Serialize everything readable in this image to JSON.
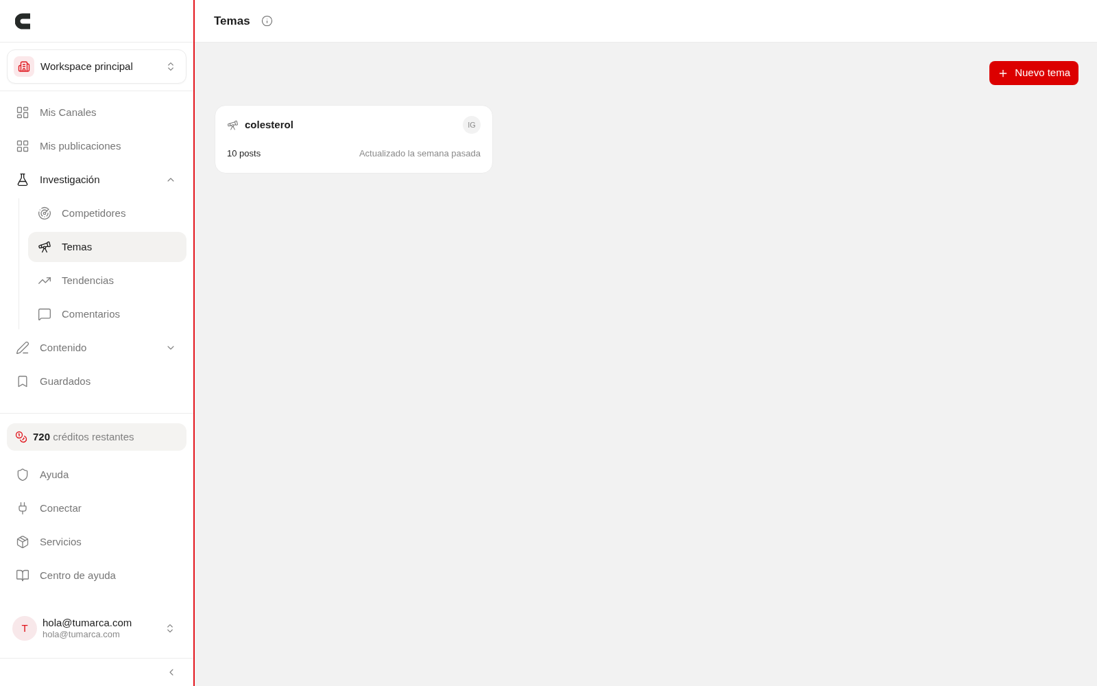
{
  "sidebar": {
    "workspace": {
      "name": "Workspace principal"
    },
    "nav": [
      {
        "kind": "link",
        "label": "Mis Canales",
        "selected": false
      },
      {
        "kind": "link",
        "label": "Mis publicaciones",
        "selected": false
      },
      {
        "kind": "group",
        "label": "Investigación",
        "selected": true,
        "expanded": true,
        "children": [
          {
            "label": "Competidores",
            "selected": false
          },
          {
            "label": "Temas",
            "selected": true
          },
          {
            "label": "Tendencias",
            "selected": false
          },
          {
            "label": "Comentarios",
            "selected": false
          }
        ]
      },
      {
        "kind": "group",
        "label": "Contenido",
        "selected": false,
        "expanded": false
      },
      {
        "kind": "link",
        "label": "Guardados",
        "selected": false
      }
    ],
    "credits": "**720** créditos restantes",
    "footer_links": [
      "Ayuda",
      "Conectar",
      "Servicios",
      "Centro de ayuda"
    ],
    "user": {
      "initial": "T",
      "name": "hola@tumarca.com",
      "email": "hola@tumarca.com"
    }
  },
  "header": {
    "title": "Temas"
  },
  "toolbar": {
    "new_button": "Nuevo tema"
  },
  "topics": [
    {
      "name": "colesterol",
      "badge": "IG",
      "posts": "10 posts",
      "updated": "Actualizado la semana pasada"
    }
  ]
}
